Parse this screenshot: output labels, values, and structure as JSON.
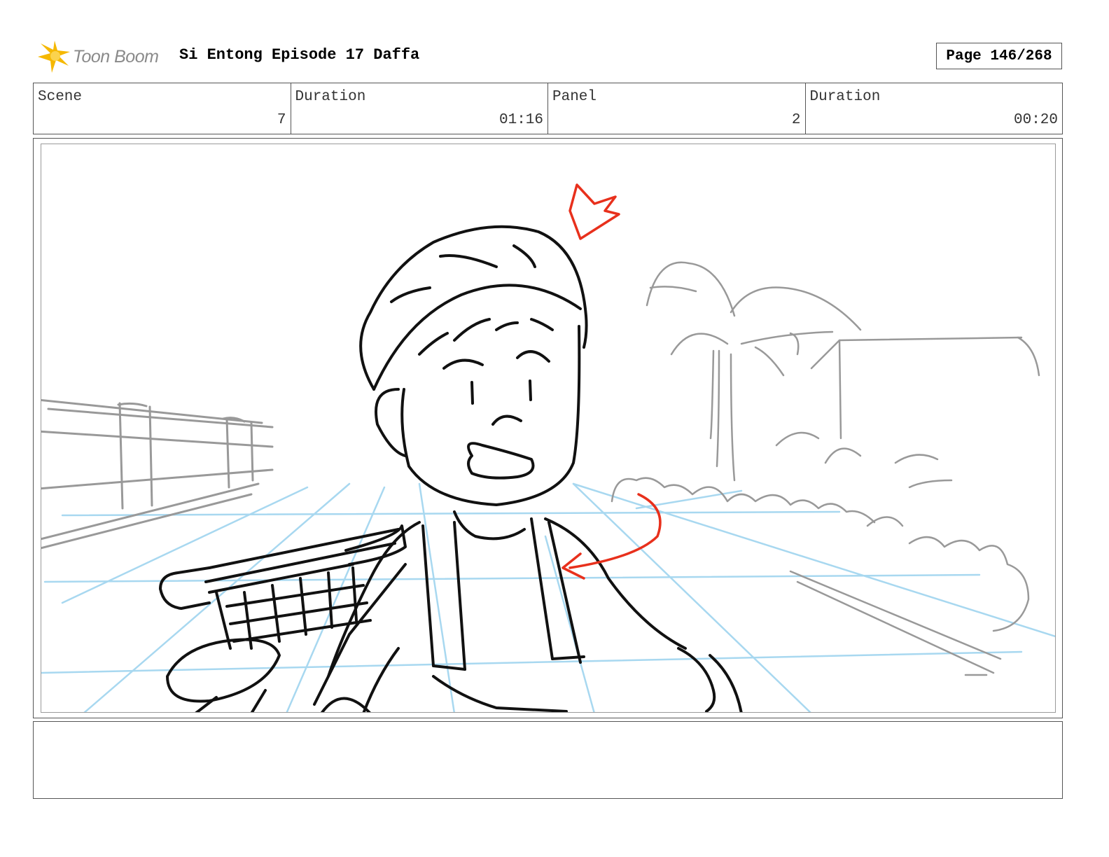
{
  "header": {
    "logo_text": "Toon Boom",
    "title": "Si Entong Episode 17 Daffa",
    "page_label": "Page 146/268"
  },
  "info": {
    "scene_label": "Scene",
    "scene_value": "7",
    "scene_duration_label": "Duration",
    "scene_duration_value": "01:16",
    "panel_label": "Panel",
    "panel_value": "2",
    "panel_duration_label": "Duration",
    "panel_duration_value": "00:20"
  },
  "notes": {
    "text": ""
  },
  "colors": {
    "sketch_ink": "#111111",
    "background_sketch": "#999999",
    "perspective_guides": "#a8d8f0",
    "red_annotation": "#e8301c",
    "logo_burst": "#f5b800"
  }
}
